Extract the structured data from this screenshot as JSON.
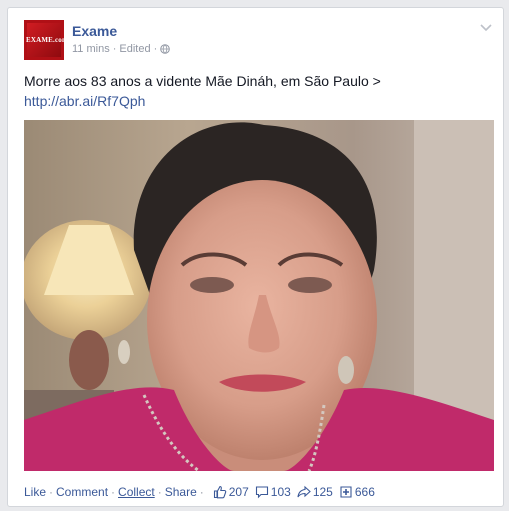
{
  "post": {
    "author": "Exame",
    "avatar_text": "EXAME.com",
    "time": "11 mins",
    "edited": "Edited",
    "dot": "·",
    "message": "Morre aos 83 anos a vidente Mãe Dináh, em São Paulo >",
    "link": "http://abr.ai/Rf7Qph"
  },
  "actions": {
    "like": "Like",
    "comment": "Comment",
    "collect": "Collect",
    "share": "Share",
    "dot": "·"
  },
  "stats": {
    "likes": "207",
    "comments": "103",
    "shares": "125",
    "collects": "666"
  },
  "colors": {
    "link": "#3b5998",
    "meta": "#9197a3",
    "brand": "#b01016"
  }
}
